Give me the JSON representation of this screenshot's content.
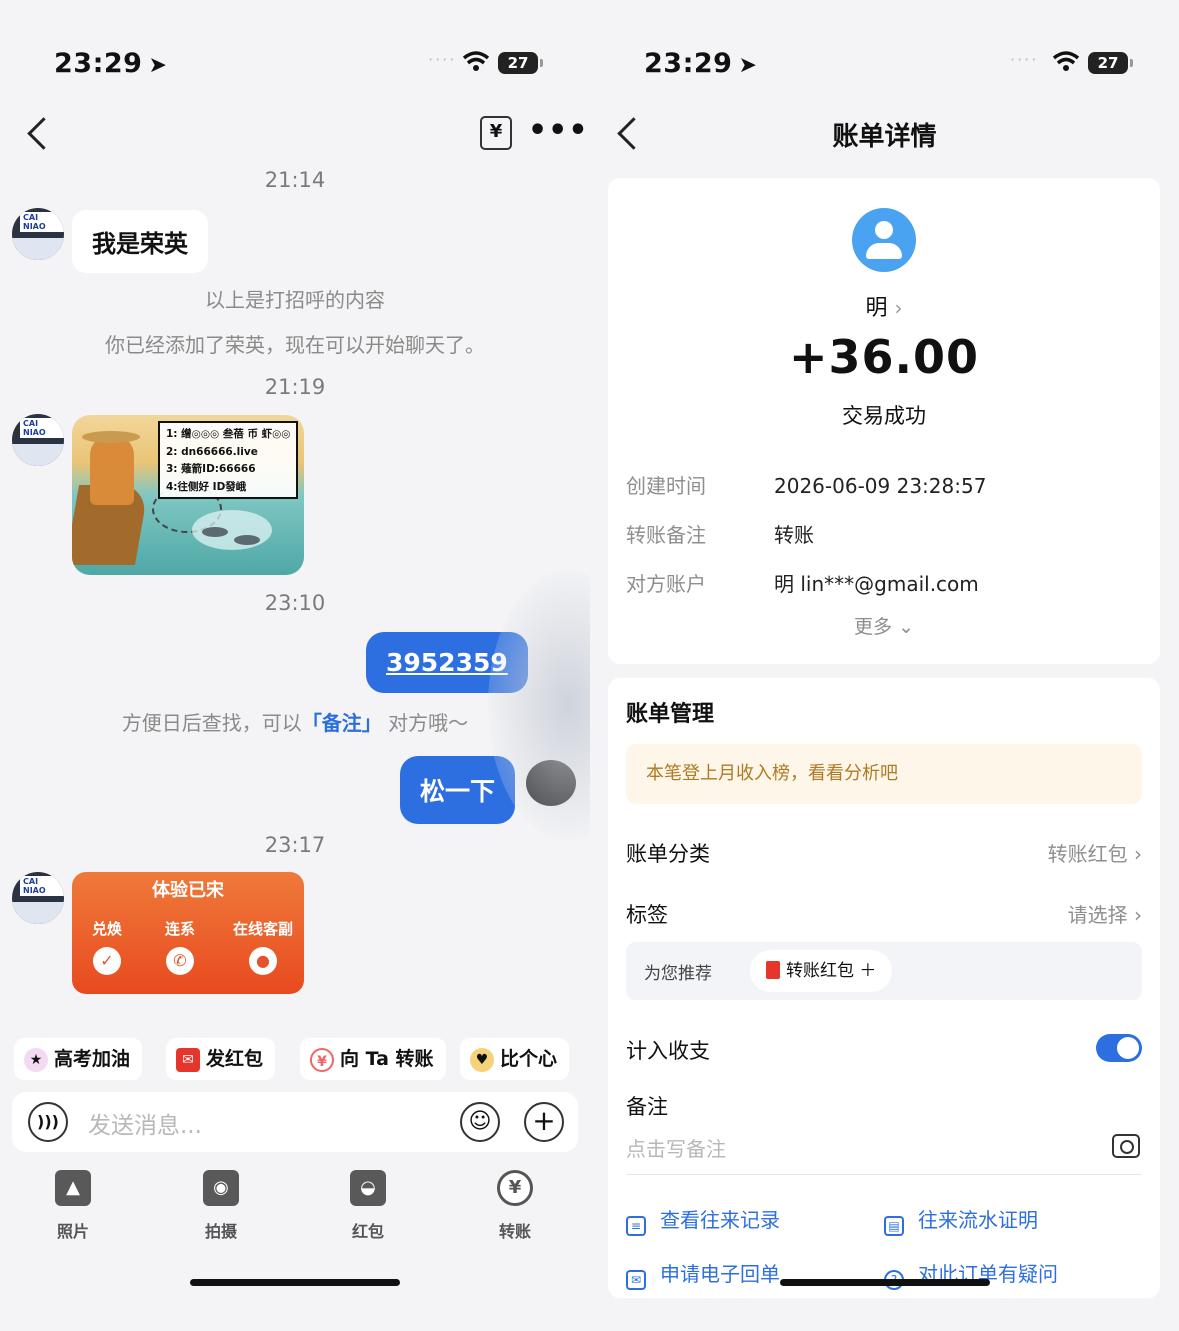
{
  "left": {
    "status": {
      "time": "23:29",
      "battery": "27"
    },
    "messages": {
      "ts1": "21:14",
      "greeting": "我是荣英",
      "sys1": "以上是打招呼的内容",
      "sys2": "你已经添加了荣英，现在可以开始聊天了。",
      "ts2": "21:19",
      "image_lines": [
        "1: 缯◎◎◎ 叁蓓 币 虾◎◎",
        "2: dn66666.live",
        "3: 薙箭ID:66666",
        "4:往侧好 ID發峨"
      ],
      "ts3": "23:10",
      "out_number": "3952359",
      "sys3_prefix": "方便日后查找，可以",
      "sys3_link": "「备注」",
      "sys3_suffix": " 对方哦～",
      "out_text": "松一下",
      "ts4": "23:17",
      "redcard_title": "体验已宋",
      "redcard_items": [
        "兑焕",
        "连系",
        "在线客副"
      ]
    },
    "chips": [
      "高考加油",
      "发红包",
      "向 Ta 转账",
      "比个心"
    ],
    "input_placeholder": "发送消息...",
    "tools": [
      "照片",
      "拍摄",
      "红包",
      "转账"
    ],
    "avatar_text": "CAI NIAO"
  },
  "right": {
    "status": {
      "time": "23:29",
      "battery": "27"
    },
    "title": "账单详情",
    "payer": "明",
    "amount": "+36.00",
    "trade_status": "交易成功",
    "details": [
      {
        "k": "创建时间",
        "v": "2026-06-09 23:28:57"
      },
      {
        "k": "转账备注",
        "v": "转账"
      },
      {
        "k": "对方账户",
        "v": "明 lin***@gmail.com"
      }
    ],
    "more": "更多",
    "manage_title": "账单管理",
    "banner": "本笔登上月收入榜，看看分析吧",
    "category_label": "账单分类",
    "category_value": "转账红包",
    "tag_label": "标签",
    "tag_value": "请选择",
    "recommend_label": "为您推荐",
    "recommend_tag": "转账红包",
    "income_label": "计入收支",
    "income_on": true,
    "note_label": "备注",
    "note_placeholder": "点击写备注",
    "actions": [
      "查看往来记录",
      "往来流水证明",
      "申请电子回单",
      "对此订单有疑问"
    ]
  },
  "colors": {
    "accent": "#2d6fe0",
    "redpacket": "#e84a1f",
    "banner_text": "#b07a23"
  }
}
